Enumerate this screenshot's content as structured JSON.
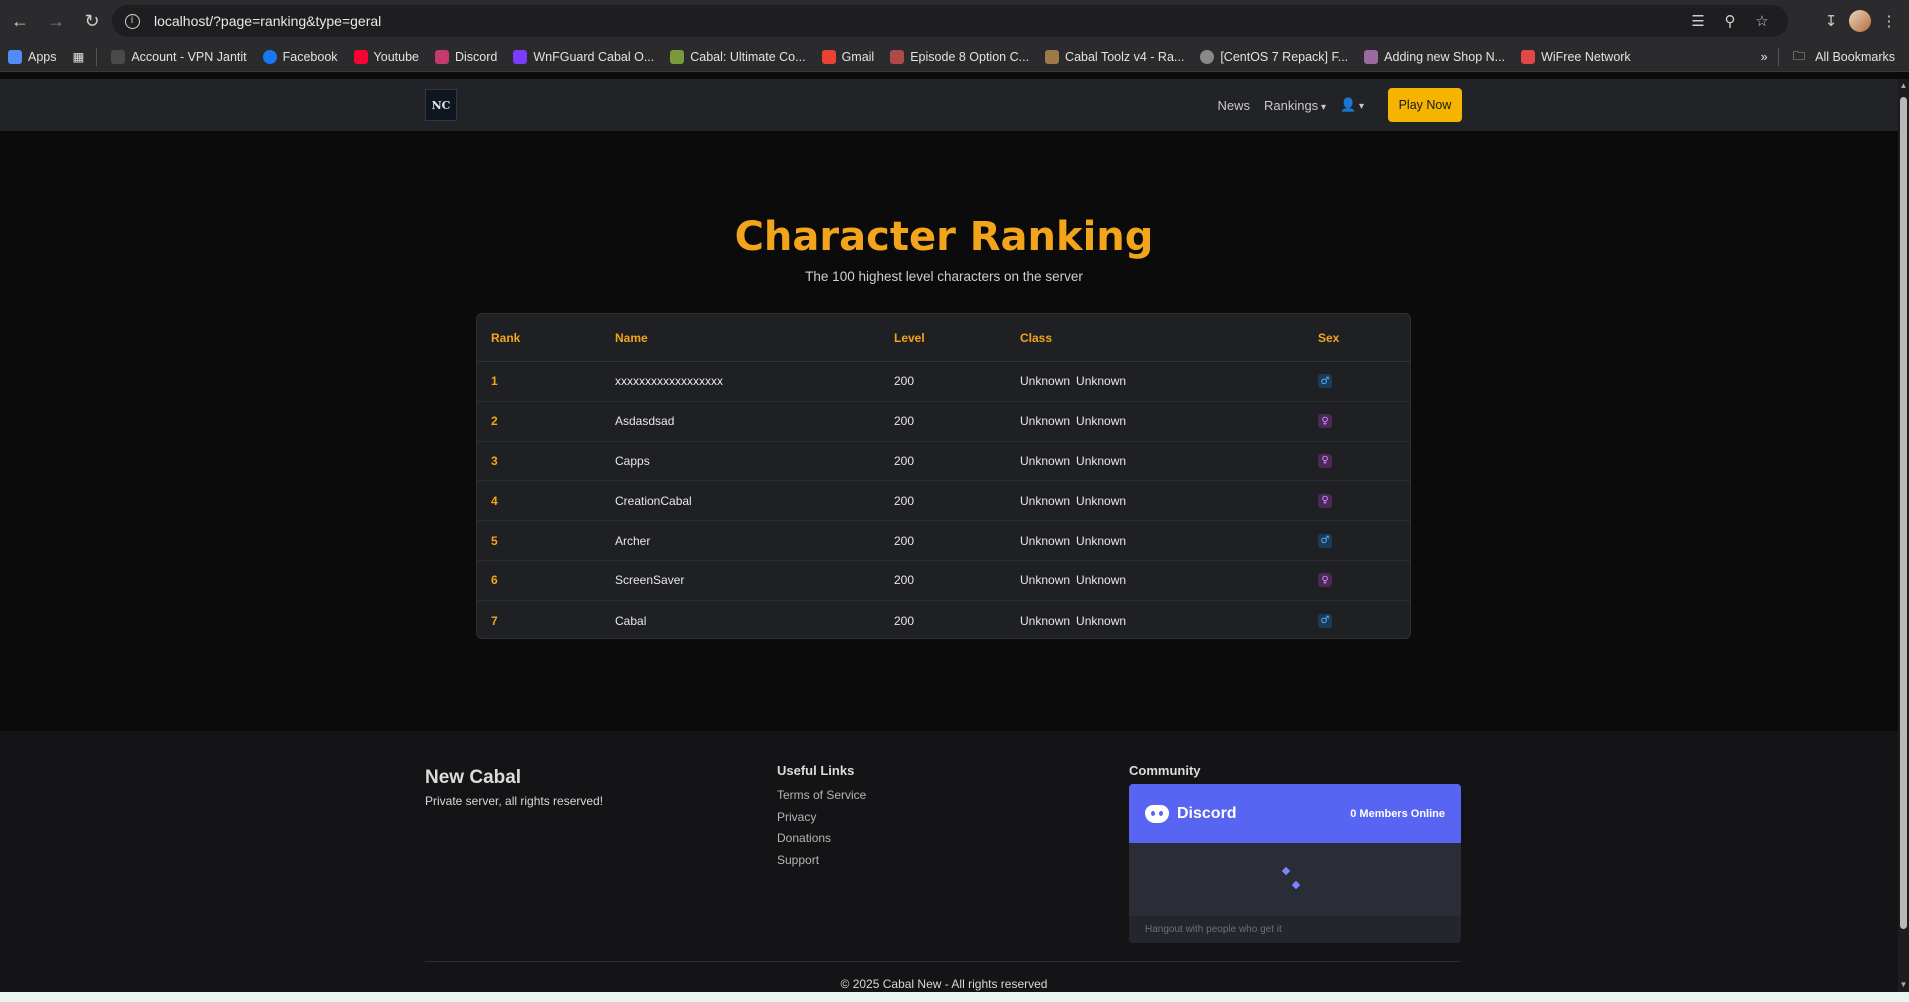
{
  "browser": {
    "url": "localhost/?page=ranking&type=geral",
    "bookmarks": [
      {
        "label": "Apps",
        "color": "#4f8df5"
      },
      {
        "label": "Account - VPN Jantit",
        "color": "#4a4a4a"
      },
      {
        "label": "Facebook",
        "color": "#1877f2"
      },
      {
        "label": "Youtube",
        "color": "#ff0033"
      },
      {
        "label": "Discord",
        "color": "#c23b6a"
      },
      {
        "label": "WnFGuard Cabal O...",
        "color": "#7a3cff"
      },
      {
        "label": "Cabal: Ultimate Co...",
        "color": "#7a9a3a"
      },
      {
        "label": "Gmail",
        "color": "#ea4335"
      },
      {
        "label": "Episode 8 Option C...",
        "color": "#b04a4a"
      },
      {
        "label": "Cabal Toolz v4 - Ra...",
        "color": "#a0784a"
      },
      {
        "label": "[CentOS 7 Repack] F...",
        "color": "#888888"
      },
      {
        "label": "Adding new Shop N...",
        "color": "#9a6aa0"
      },
      {
        "label": "WiFree Network",
        "color": "#e04848"
      }
    ],
    "all_bookmarks_label": "All Bookmarks"
  },
  "site": {
    "logo_text": "NC",
    "nav": {
      "news": "News",
      "rankings": "Rankings",
      "play_now": "Play Now"
    }
  },
  "ranking": {
    "title": "Character Ranking",
    "subtitle": "The 100 highest level characters on the server",
    "columns": {
      "rank": "Rank",
      "name": "Name",
      "level": "Level",
      "class": "Class",
      "sex": "Sex"
    },
    "rows": [
      {
        "rank": "1",
        "name": "xxxxxxxxxxxxxxxxxx",
        "level": "200",
        "class_a": "Unknown",
        "class_b": "Unknown",
        "sex": "male"
      },
      {
        "rank": "2",
        "name": "Asdasdsad",
        "level": "200",
        "class_a": "Unknown",
        "class_b": "Unknown",
        "sex": "female"
      },
      {
        "rank": "3",
        "name": "Capps",
        "level": "200",
        "class_a": "Unknown",
        "class_b": "Unknown",
        "sex": "female"
      },
      {
        "rank": "4",
        "name": "CreationCabal",
        "level": "200",
        "class_a": "Unknown",
        "class_b": "Unknown",
        "sex": "female"
      },
      {
        "rank": "5",
        "name": "Archer",
        "level": "200",
        "class_a": "Unknown",
        "class_b": "Unknown",
        "sex": "male"
      },
      {
        "rank": "6",
        "name": "ScreenSaver",
        "level": "200",
        "class_a": "Unknown",
        "class_b": "Unknown",
        "sex": "female"
      },
      {
        "rank": "7",
        "name": "Cabal",
        "level": "200",
        "class_a": "Unknown",
        "class_b": "Unknown",
        "sex": "male"
      }
    ]
  },
  "footer": {
    "brand": "New Cabal",
    "tagline": "Private server, all rights reserved!",
    "links_title": "Useful Links",
    "links": [
      "Terms of Service",
      "Privacy",
      "Donations",
      "Support"
    ],
    "community_title": "Community",
    "discord": {
      "name": "Discord",
      "members_online": "0 Members Online",
      "footer_text": "Hangout with people who get it"
    },
    "copyright": "© 2025 Cabal New - All rights reserved"
  },
  "colors": {
    "accent": "#f2a51a",
    "play_button": "#f4b400",
    "discord": "#5865f2"
  }
}
